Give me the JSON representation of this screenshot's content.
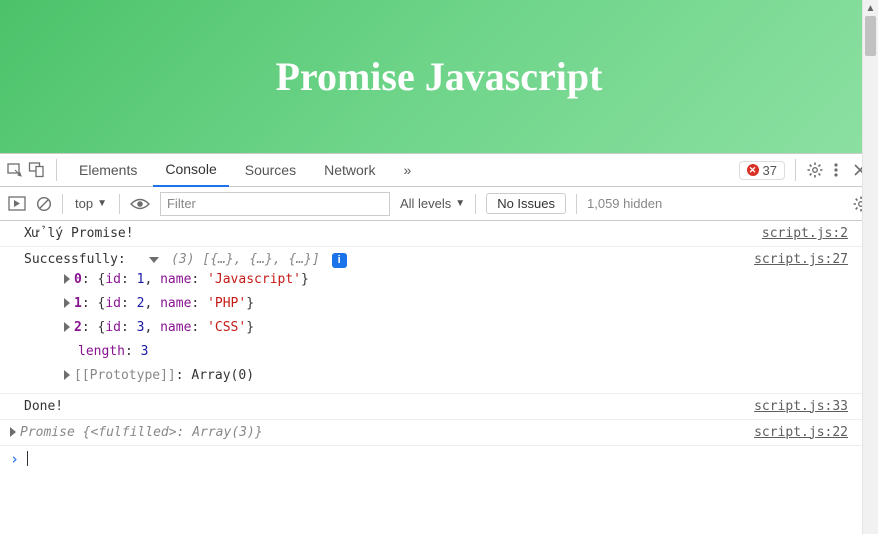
{
  "banner": {
    "title": "Promise Javascript"
  },
  "devtools": {
    "tabs": [
      "Elements",
      "Console",
      "Sources",
      "Network"
    ],
    "active_tab": "Console",
    "overflow_glyph": "»",
    "error_count": "37",
    "toolbar": {
      "context": "top",
      "filter_placeholder": "Filter",
      "levels": "All levels",
      "issues_btn": "No Issues",
      "hidden": "1,059 hidden"
    }
  },
  "logs": [
    {
      "text": "Xử lý Promise!",
      "src": "script.js:2"
    }
  ],
  "array_log": {
    "prefix": "Successfully: ",
    "summary_len": "(3)",
    "summary_body": "[{…}, {…}, {…}]",
    "src": "script.js:27",
    "items": [
      {
        "index": "0",
        "id": "1",
        "name": "'Javascript'"
      },
      {
        "index": "1",
        "id": "2",
        "name": "'PHP'"
      },
      {
        "index": "2",
        "id": "3",
        "name": "'CSS'"
      }
    ],
    "length_label": "length",
    "length_val": "3",
    "proto": "[[Prototype]]",
    "proto_val": "Array(0)"
  },
  "done_log": {
    "text": "Done!",
    "src": "script.js:33"
  },
  "promise_log": {
    "preface": "Promise ",
    "state": "<fulfilled>",
    "value": "Array(3)",
    "src": "script.js:22"
  },
  "labels": {
    "id": "id",
    "name": "name"
  }
}
